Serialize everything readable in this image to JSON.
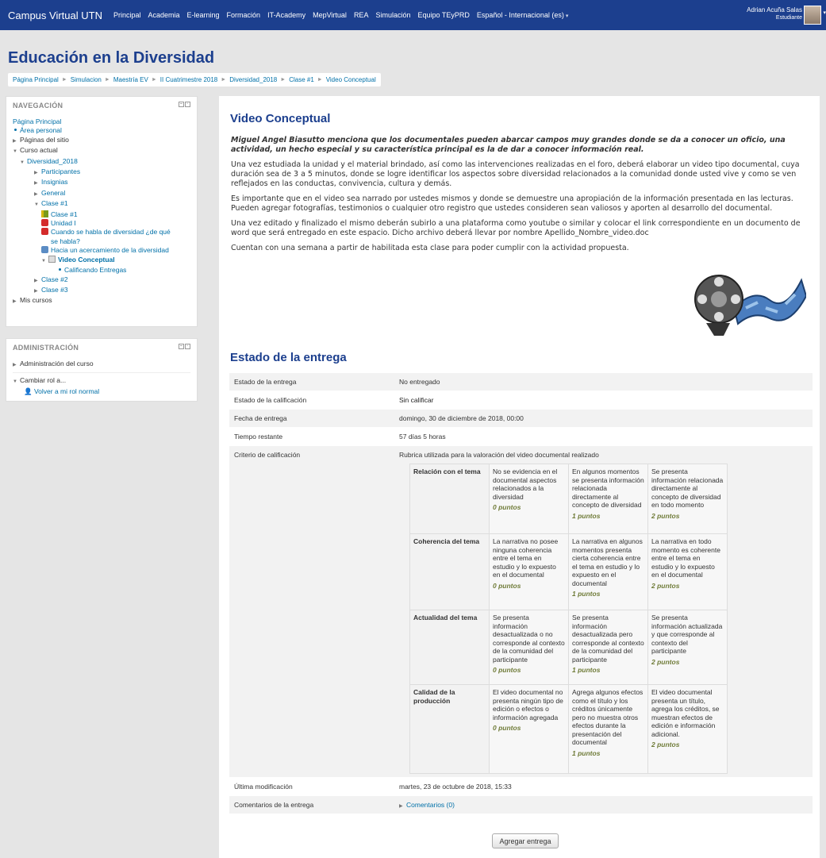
{
  "navbar": {
    "brand": "Campus Virtual UTN",
    "items": [
      "Principal",
      "Academia",
      "E-learning",
      "Formación",
      "IT-Academy",
      "MepVirtual",
      "REA",
      "Simulación",
      "Equipo TEyPRD",
      "Español - Internacional (es)"
    ],
    "user_name": "Adrian Acuña Salas",
    "user_role": "Estudiante"
  },
  "header": {
    "title": "Educación en la Diversidad",
    "breadcrumb": [
      "Página Principal",
      "Simulacion",
      "Maestría EV",
      "II Cuatrimestre 2018",
      "Diversidad_2018",
      "Clase #1",
      "Video Conceptual"
    ]
  },
  "navigation": {
    "title": "NAVEGACIÓN",
    "items": [
      {
        "label": "Página Principal"
      },
      {
        "label": "Área personal"
      },
      {
        "label": "Páginas del sitio"
      },
      {
        "label": "Curso actual"
      },
      {
        "label": "Diversidad_2018"
      },
      {
        "label": "Participantes"
      },
      {
        "label": "Insignias"
      },
      {
        "label": "General"
      },
      {
        "label": "Clase #1"
      },
      {
        "label": "Clase #1"
      },
      {
        "label": "Unidad I"
      },
      {
        "label": "Cuando se habla de diversidad ¿de qué se habla?"
      },
      {
        "label": "Hacia un acercamiento de la diversidad"
      },
      {
        "label": "Video Conceptual"
      },
      {
        "label": "Calificando Entregas"
      },
      {
        "label": "Clase #2"
      },
      {
        "label": "Clase #3"
      },
      {
        "label": "Mis cursos"
      }
    ]
  },
  "administration": {
    "title": "ADMINISTRACIÓN",
    "course_admin": "Administración del curso",
    "change_role": "Cambiar rol a...",
    "normal_role": "Volver a mi rol normal"
  },
  "main": {
    "title": "Video Conceptual",
    "lead": "Miguel Angel Biasutto menciona que los documentales pueden abarcar campos muy grandes donde se da a conocer un oficio, una actividad, un hecho especial y su característica principal es la de dar a conocer información real.",
    "paragraphs": [
      "Una vez estudiada la unidad y el material brindado, así como las intervenciones realizadas en el foro, deberá elaborar un video tipo documental, cuya duración sea de 3 a 5 minutos, donde se logre identificar los aspectos sobre diversidad relacionados a la comunidad donde usted vive y como se ven reflejados en las conductas, convivencia, cultura y demás.",
      "Es importante que en el video sea narrado por ustedes mismos y donde se demuestre una apropiación de la información presentada en las lecturas. Pueden agregar fotografías, testimonios o cualquier otro registro que ustedes consideren sean valiosos y aporten al desarrollo del documental.",
      "Una vez editado y finalizado el mismo deberán subirlo a una plataforma como youtube o similar y colocar el link correspondiente en un documento de word que será entregado en este espacio. Dicho archivo deberá llevar por nombre Apellido_Nombre_video.doc",
      "Cuentan con una semana a partir de habilitada esta clase para poder cumplir con la actividad propuesta."
    ],
    "status_title": "Estado de la entrega",
    "status": {
      "submission_label": "Estado de la entrega",
      "submission_value": "No entregado",
      "grading_label": "Estado de la calificación",
      "grading_value": "Sin calificar",
      "due_label": "Fecha de entrega",
      "due_value": "domingo, 30 de diciembre de 2018, 00:00",
      "remaining_label": "Tiempo restante",
      "remaining_value": "57 días 5 horas",
      "criteria_label": "Criterio de calificación",
      "criteria_value": "Rubrica utilizada para la valoración del video documental realizado",
      "modified_label": "Última modificación",
      "modified_value": "martes, 23 de octubre de 2018, 15:33",
      "comments_label": "Comentarios de la entrega",
      "comments_value": "Comentarios (0)"
    },
    "rubric": [
      {
        "criterion": "Relación con el tema",
        "levels": [
          {
            "text": "No se evidencia en el documental aspectos relacionados a la diversidad",
            "points": "0 puntos"
          },
          {
            "text": "En algunos momentos se presenta información relacionada directamente al concepto de diversidad",
            "points": "1 puntos"
          },
          {
            "text": "Se presenta información relacionada directamente al concepto de diversidad en todo momento",
            "points": "2 puntos"
          }
        ]
      },
      {
        "criterion": "Coherencia del tema",
        "levels": [
          {
            "text": "La narrativa no posee ninguna coherencia entre el tema en estudio y lo expuesto en el documental",
            "points": "0 puntos"
          },
          {
            "text": "La narrativa en algunos momentos presenta cierta coherencia entre el tema en estudio y lo expuesto en el documental",
            "points": "1 puntos"
          },
          {
            "text": "La narrativa en todo momento es coherente entre el tema en estudio y lo expuesto en el documental",
            "points": "2 puntos"
          }
        ]
      },
      {
        "criterion": "Actualidad del tema",
        "levels": [
          {
            "text": "Se presenta información desactualizada o no corresponde al contexto de la comunidad del participante",
            "points": "0 puntos"
          },
          {
            "text": "Se presenta información desactualizada pero corresponde al contexto de la comunidad del participante",
            "points": "1 puntos"
          },
          {
            "text": "Se presenta información actualizada y que corresponde al contexto del participante",
            "points": "2 puntos"
          }
        ]
      },
      {
        "criterion": "Calidad de la producción",
        "levels": [
          {
            "text": "El video documental no presenta ningún tipo de edición o efectos o información agregada",
            "points": "0 puntos"
          },
          {
            "text": "Agrega algunos efectos como el título y los créditos únicamente pero no muestra otros efectos durante la presentación del documental",
            "points": "1 puntos"
          },
          {
            "text": "El video documental presenta un título, agrega los créditos, se muestran efectos de edición e información adicional.",
            "points": "2 puntos"
          }
        ]
      }
    ],
    "add_button": "Agregar entrega"
  }
}
